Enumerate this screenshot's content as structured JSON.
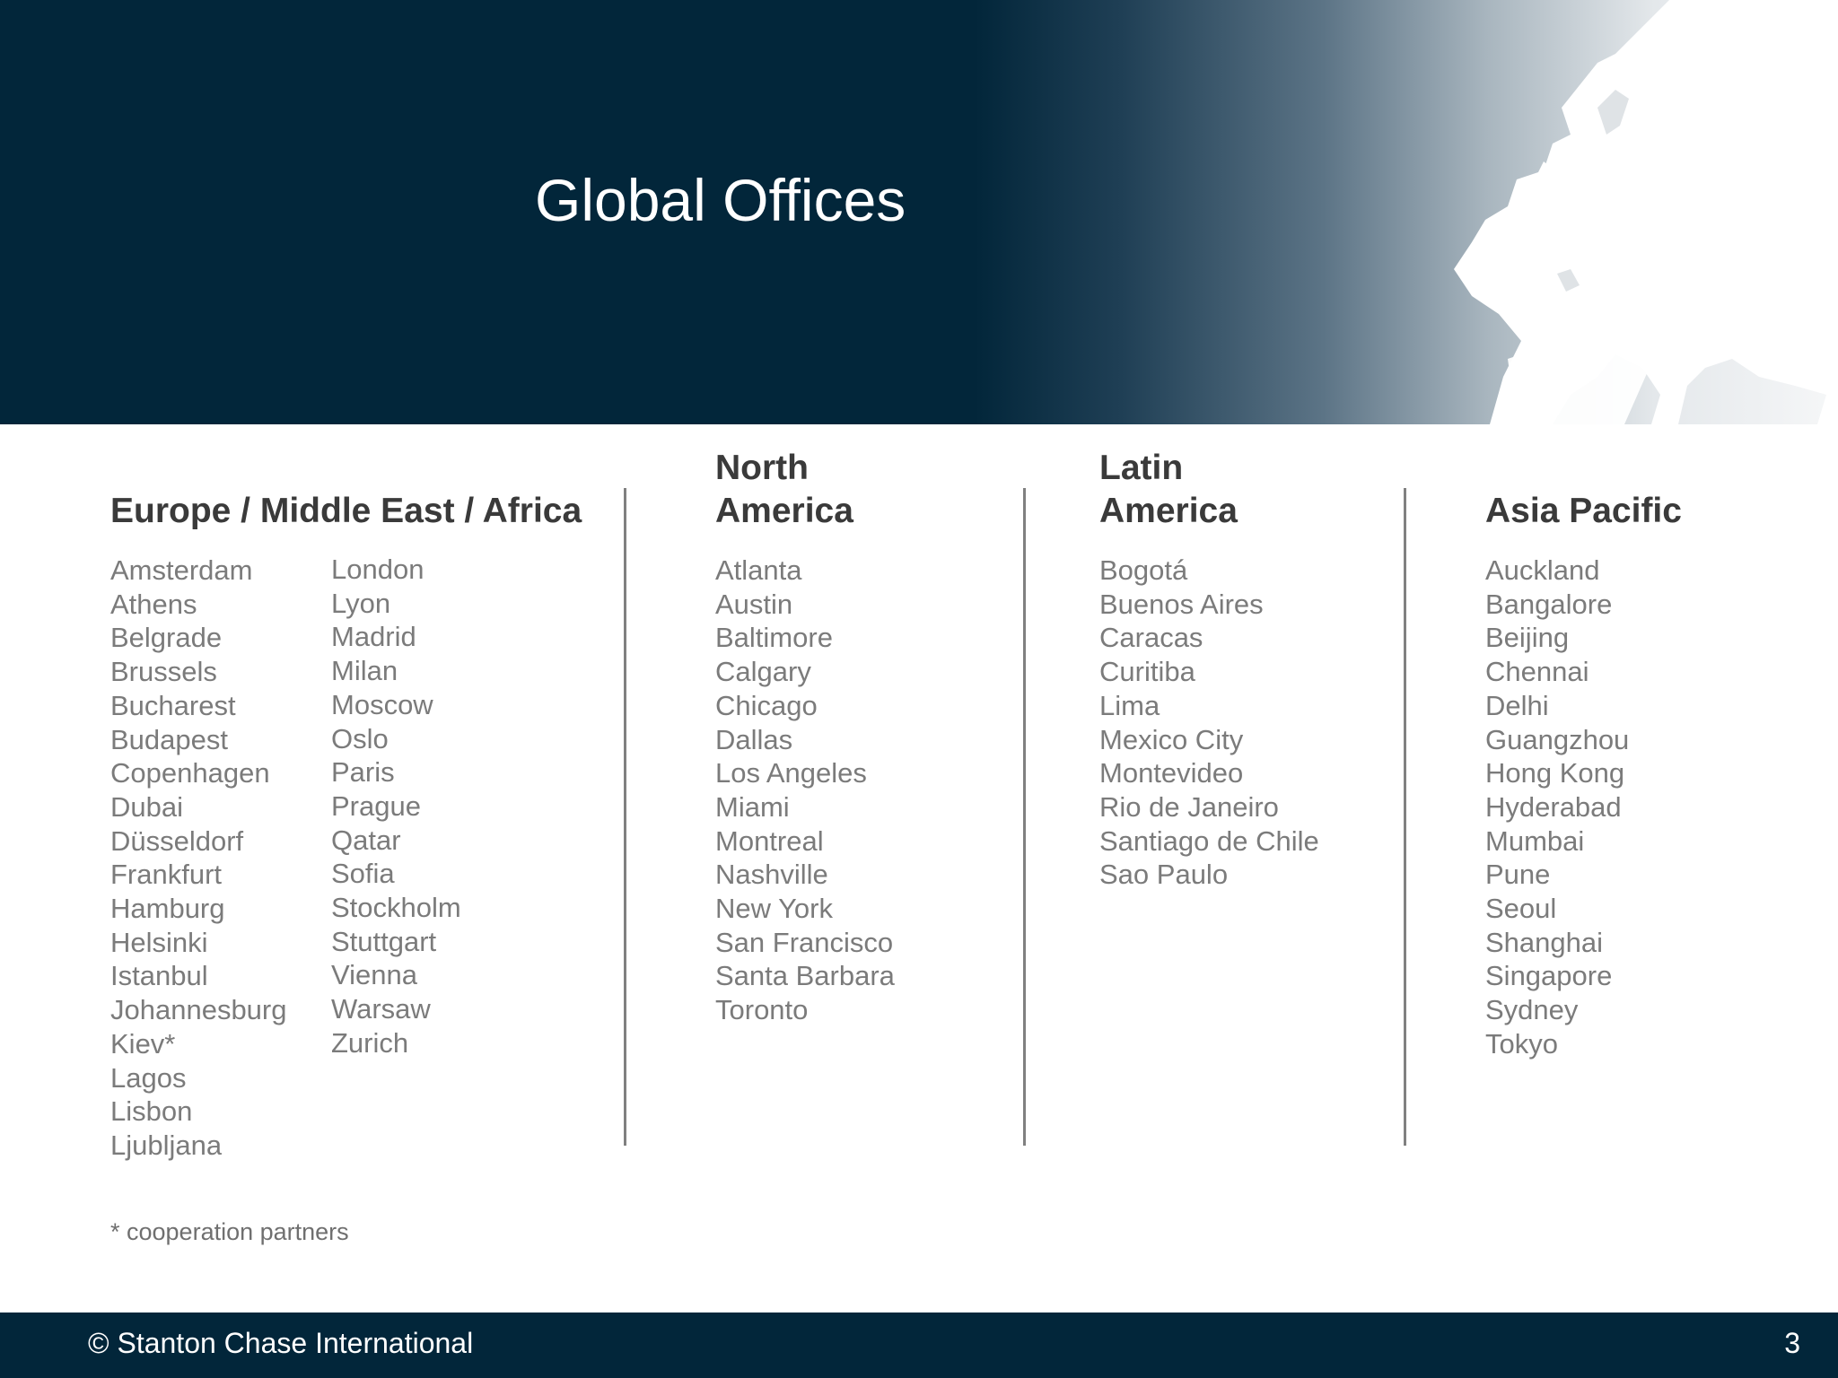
{
  "title": "Global Offices",
  "regions": {
    "emea": {
      "heading": "Europe / Middle East / Africa",
      "cities_col1": [
        "Amsterdam",
        "Athens",
        "Belgrade",
        "Brussels",
        "Bucharest",
        "Budapest",
        "Copenhagen",
        "Dubai",
        "Düsseldorf",
        "Frankfurt",
        "Hamburg",
        "Helsinki",
        "Istanbul",
        "Johannesburg",
        "Kiev*",
        "Lagos",
        "Lisbon",
        "Ljubljana"
      ],
      "cities_col2": [
        "London",
        "Lyon",
        "Madrid",
        "Milan",
        "Moscow",
        "Oslo",
        "Paris",
        "Prague",
        "Qatar",
        "Sofia",
        "Stockholm",
        "Stuttgart",
        "Vienna",
        "Warsaw",
        "Zurich"
      ]
    },
    "north_america": {
      "heading_line1": "North",
      "heading_line2": "America",
      "cities": [
        "Atlanta",
        "Austin",
        "Baltimore",
        "Calgary",
        "Chicago",
        "Dallas",
        "Los Angeles",
        "Miami",
        "Montreal",
        "Nashville",
        "New York",
        "San Francisco",
        "Santa Barbara",
        "Toronto"
      ]
    },
    "latin_america": {
      "heading_line1": "Latin",
      "heading_line2": "America",
      "cities": [
        "Bogotá",
        "Buenos Aires",
        "Caracas",
        "Curitiba",
        "Lima",
        "Mexico City",
        "Montevideo",
        "Rio de Janeiro",
        "Santiago de Chile",
        "Sao Paulo"
      ]
    },
    "asia_pacific": {
      "heading": "Asia Pacific",
      "cities": [
        "Auckland",
        "Bangalore",
        "Beijing",
        "Chennai",
        "Delhi",
        "Guangzhou",
        "Hong Kong",
        "Hyderabad",
        "Mumbai",
        "Pune",
        "Seoul",
        "Shanghai",
        "Singapore",
        "Sydney",
        "Tokyo"
      ]
    }
  },
  "footnote": "* cooperation partners",
  "footer": {
    "copyright": "© Stanton Chase International",
    "page_number": "3"
  },
  "colors": {
    "header_navy": "#02263a",
    "heading_text": "#3a3a3a",
    "city_text": "#7b7b7b",
    "divider": "#808080"
  }
}
